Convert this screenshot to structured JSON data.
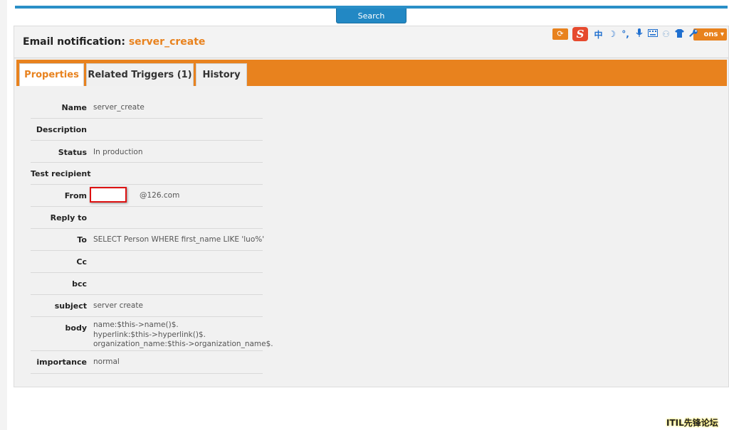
{
  "search": {
    "label": "Search"
  },
  "header": {
    "title_prefix": "Email notification:",
    "object_name": "server_create",
    "actions_label": "ons"
  },
  "ime_toolbar": {
    "logo": "S",
    "mode": "中",
    "items": [
      "moon-icon",
      "punctuation-icon",
      "microphone-icon",
      "keyboard-icon",
      "user-icon",
      "skin-icon",
      "wrench-icon"
    ]
  },
  "tabs": [
    {
      "label": "Properties",
      "active": true
    },
    {
      "label": "Related Triggers (1)",
      "active": false
    },
    {
      "label": "History",
      "active": false
    }
  ],
  "properties": [
    {
      "label": "Name",
      "value": "server_create"
    },
    {
      "label": "Description",
      "value": ""
    },
    {
      "label": "Status",
      "value": "In production"
    },
    {
      "label": "Test recipient",
      "value": ""
    },
    {
      "label": "From",
      "value": "@126.com"
    },
    {
      "label": "Reply to",
      "value": ""
    },
    {
      "label": "To",
      "value": "SELECT Person WHERE first_name LIKE 'luo%'"
    },
    {
      "label": "Cc",
      "value": ""
    },
    {
      "label": "bcc",
      "value": ""
    },
    {
      "label": "subject",
      "value": "server create"
    },
    {
      "label": "body",
      "value": "name:$this->name()$.\nhyperlink:$this->hyperlink()$.\norganization_name:$this->organization_name$."
    },
    {
      "label": "importance",
      "value": "normal"
    }
  ],
  "watermark": "ITIL先锋论坛",
  "colors": {
    "accent": "#e8821e",
    "topbar": "#2a8fc7",
    "redact_border": "#dd1111"
  }
}
